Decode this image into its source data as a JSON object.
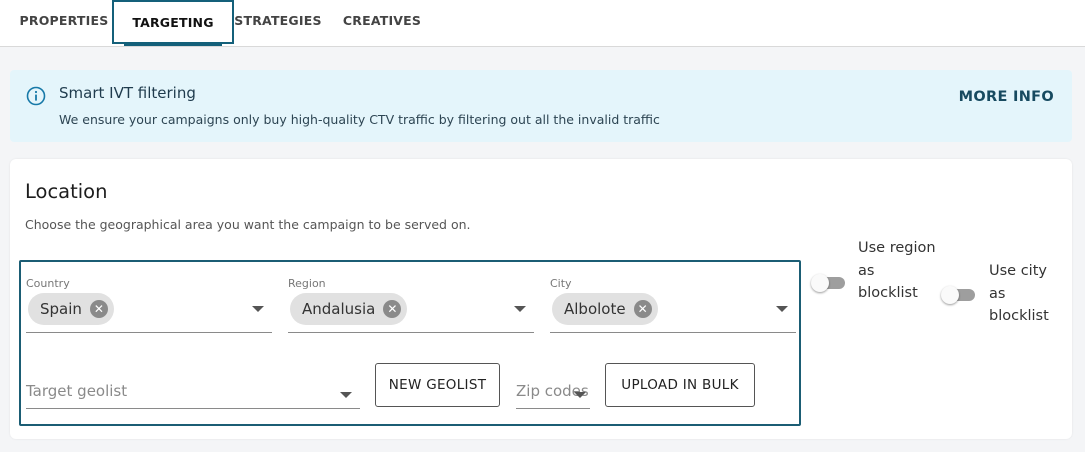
{
  "tabs": [
    {
      "label": "PROPERTIES",
      "active": false
    },
    {
      "label": "TARGETING",
      "active": true
    },
    {
      "label": "STRATEGIES",
      "active": false
    },
    {
      "label": "CREATIVES",
      "active": false
    }
  ],
  "banner": {
    "icon": "info-icon",
    "title": "Smart IVT filtering",
    "text": "We ensure your campaigns only buy high-quality CTV traffic by filtering out all the invalid traffic",
    "action": "MORE INFO"
  },
  "location": {
    "title": "Location",
    "subtitle": "Choose the geographical area you want the campaign to be served on.",
    "country": {
      "label": "Country",
      "value": "Spain"
    },
    "region": {
      "label": "Region",
      "value": "Andalusia"
    },
    "city": {
      "label": "City",
      "value": "Albolote"
    },
    "geolist": {
      "placeholder": "Target geolist"
    },
    "new_geolist_button": "NEW GEOLIST",
    "zip": {
      "placeholder": "Zip codes"
    },
    "upload_button": "UPLOAD IN BULK",
    "region_blocklist": {
      "label": "Use region as blocklist",
      "enabled": false
    },
    "city_blocklist": {
      "label": "Use city as blocklist",
      "enabled": false
    }
  },
  "colors": {
    "accent": "#14607a",
    "banner_bg": "#e4f5fb",
    "chip_bg": "#e1e1e1"
  }
}
